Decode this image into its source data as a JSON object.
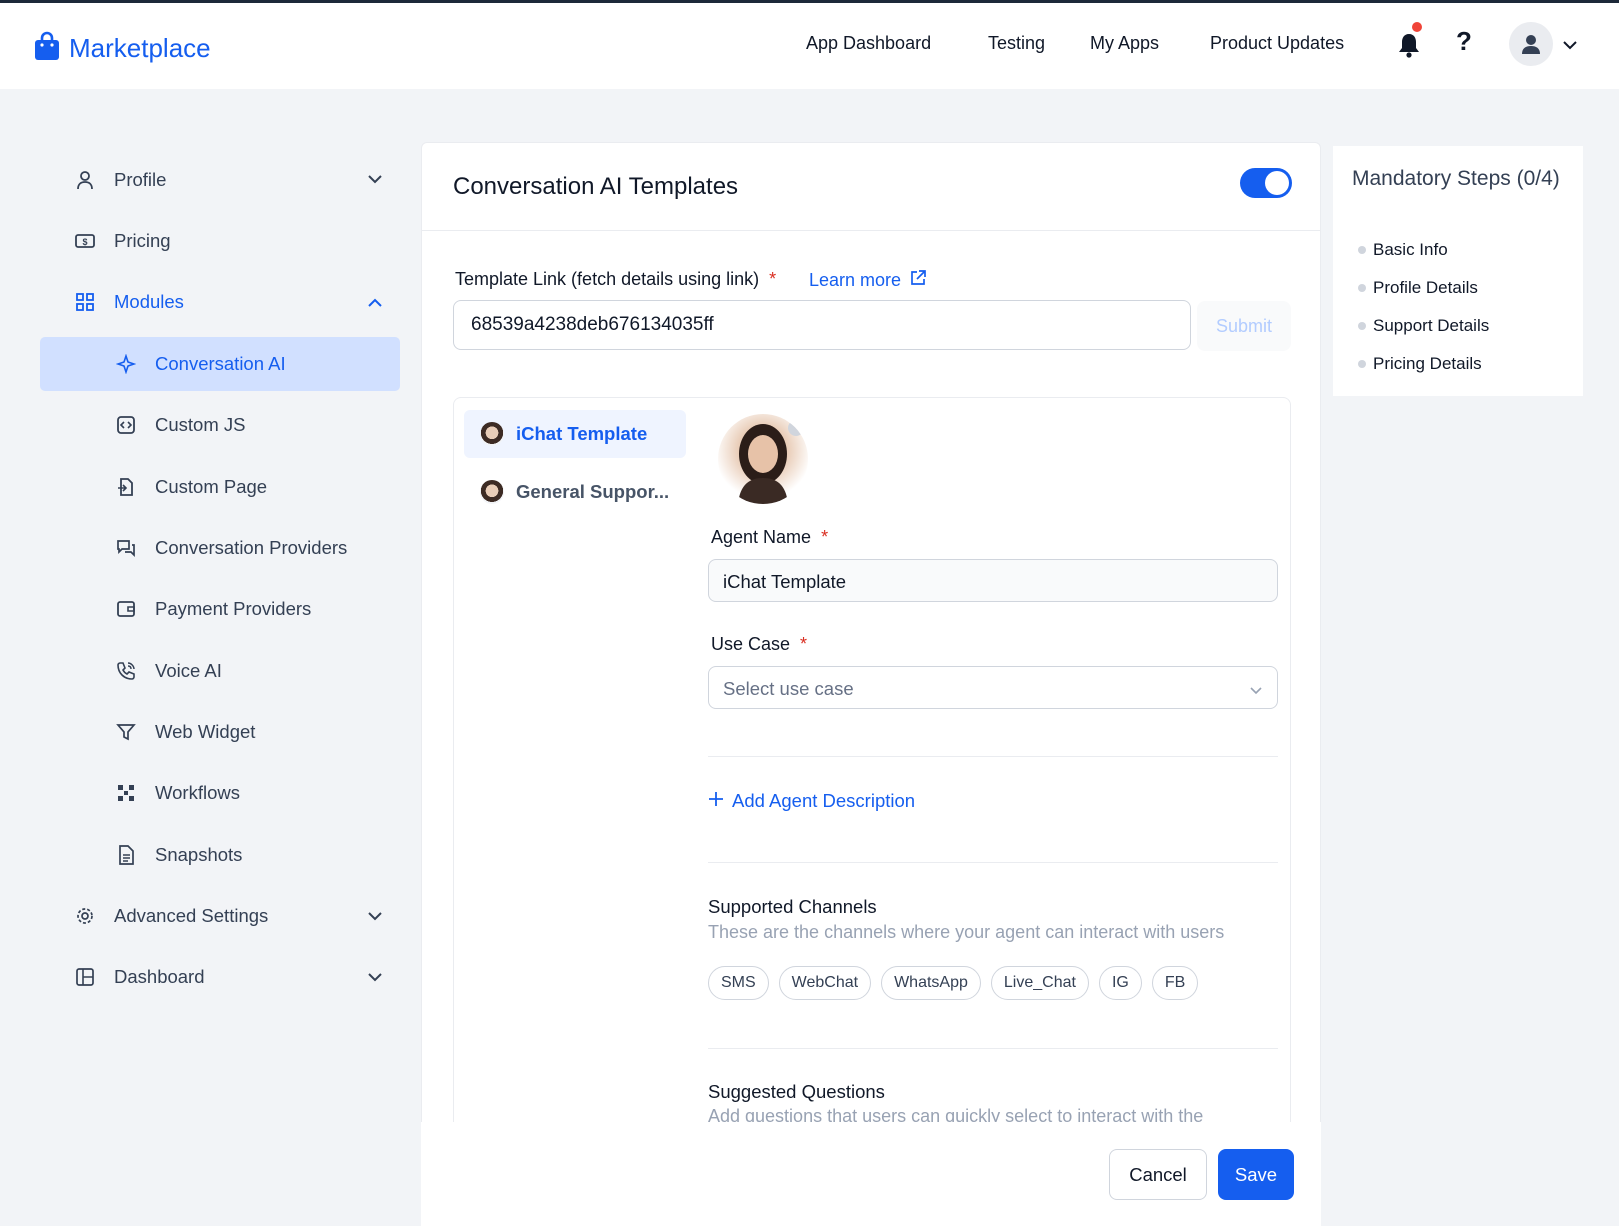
{
  "header": {
    "brand": "Marketplace",
    "nav": [
      "App Dashboard",
      "Testing",
      "My Apps",
      "Product Updates"
    ],
    "help_label": "?"
  },
  "sidebar": {
    "items": [
      {
        "label": "Profile",
        "icon": "user-icon",
        "chevron": "down"
      },
      {
        "label": "Pricing",
        "icon": "dollar-bill-icon"
      },
      {
        "label": "Modules",
        "icon": "grid-icon",
        "chevron": "up",
        "expanded": true
      },
      {
        "label": "Conversation AI",
        "icon": "sparkle-icon",
        "active": true
      },
      {
        "label": "Custom JS",
        "icon": "code-icon"
      },
      {
        "label": "Custom Page",
        "icon": "page-icon"
      },
      {
        "label": "Conversation Providers",
        "icon": "chat-bubbles-icon"
      },
      {
        "label": "Payment Providers",
        "icon": "wallet-icon"
      },
      {
        "label": "Voice AI",
        "icon": "phone-icon"
      },
      {
        "label": "Web Widget",
        "icon": "filter-icon"
      },
      {
        "label": "Workflows",
        "icon": "workflow-icon"
      },
      {
        "label": "Snapshots",
        "icon": "document-icon"
      },
      {
        "label": "Advanced Settings",
        "icon": "gear-icon",
        "chevron": "down"
      },
      {
        "label": "Dashboard",
        "icon": "layout-icon",
        "chevron": "down"
      }
    ]
  },
  "main": {
    "title": "Conversation AI Templates",
    "enabled": true,
    "template_link_label": "Template Link (fetch details using link)",
    "required_mark": "*",
    "learn_more": "Learn more",
    "template_link_value": "68539a4238deb676134035ff",
    "submit_label": "Submit",
    "templates": [
      {
        "name": "iChat Template",
        "active": true
      },
      {
        "name": "General Suppor..."
      }
    ],
    "agent_name_label": "Agent Name",
    "agent_name_value": "iChat Template",
    "use_case_label": "Use Case",
    "use_case_placeholder": "Select use case",
    "add_description": "Add Agent Description",
    "supported_channels_title": "Supported Channels",
    "supported_channels_sub": "These are the channels where your agent can interact with users",
    "channels": [
      "SMS",
      "WebChat",
      "WhatsApp",
      "Live_Chat",
      "IG",
      "FB"
    ],
    "suggested_title": "Suggested Questions",
    "suggested_sub": "Add questions that users can quickly select to interact with the",
    "cancel_label": "Cancel",
    "save_label": "Save"
  },
  "steps": {
    "title": "Mandatory Steps (0/4)",
    "items": [
      "Basic Info",
      "Profile Details",
      "Support Details",
      "Pricing Details"
    ]
  },
  "colors": {
    "accent": "#155eef",
    "active_bg": "#d1e0ff",
    "required": "#d92d20",
    "notification": "#f04438"
  }
}
